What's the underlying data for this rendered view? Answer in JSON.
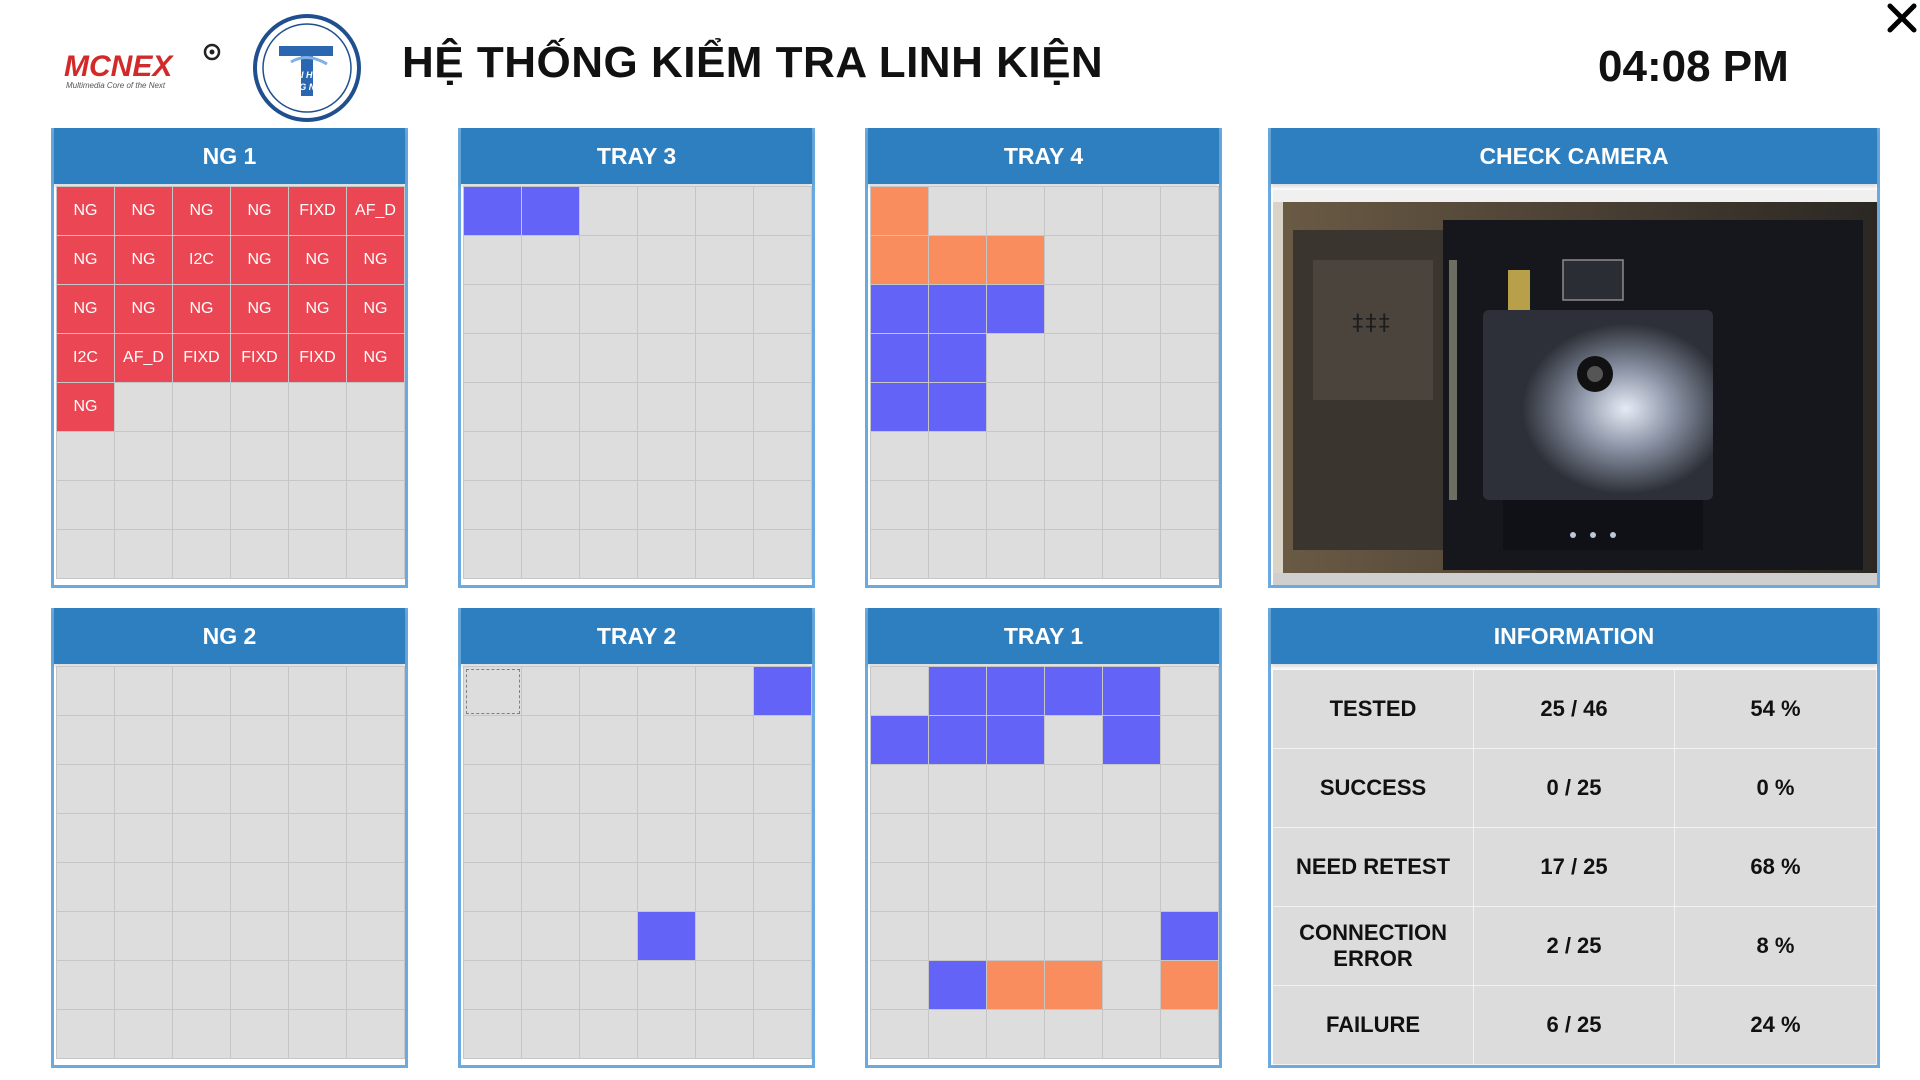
{
  "header": {
    "brand": "MCNEX",
    "brand_tagline": "Multimedia Core of the Next",
    "university_logo_text": [
      "ĐẠI HỌC",
      "CÔNG NGHỆ"
    ],
    "title": "HỆ THỐNG KIỂM TRA LINH KIỆN",
    "time": "04:08 PM",
    "close_icon": "close-icon"
  },
  "colors": {
    "header_bar": "#2e7fbf",
    "panel_border": "#6aaae0",
    "cell_empty": "#dddddd",
    "status_tested": "#6363f8",
    "status_retest": "#f98d5e",
    "status_failed": "#eb4653"
  },
  "trays": {
    "ng1": {
      "title": "NG 1",
      "cells": [
        [
          "NG",
          "NG",
          "NG",
          "NG",
          "FIXD",
          "AF_D"
        ],
        [
          "NG",
          "NG",
          "I2C",
          "NG",
          "NG",
          "NG"
        ],
        [
          "NG",
          "NG",
          "NG",
          "NG",
          "NG",
          "NG"
        ],
        [
          "I2C",
          "AF_D",
          "FIXD",
          "FIXD",
          "FIXD",
          "NG"
        ],
        [
          "NG",
          "",
          "",
          "",
          "",
          ""
        ],
        [
          "",
          "",
          "",
          "",
          "",
          ""
        ],
        [
          "",
          "",
          "",
          "",
          "",
          ""
        ],
        [
          "",
          "",
          "",
          "",
          "",
          ""
        ]
      ],
      "states": [
        [
          "red",
          "red",
          "red",
          "red",
          "red",
          "red"
        ],
        [
          "red",
          "red",
          "red",
          "red",
          "red",
          "red"
        ],
        [
          "red",
          "red",
          "red",
          "red",
          "red",
          "red"
        ],
        [
          "red",
          "red",
          "red",
          "red",
          "red",
          "red"
        ],
        [
          "red",
          "",
          "",
          "",
          "",
          ""
        ],
        [
          "",
          "",
          "",
          "",
          "",
          ""
        ],
        [
          "",
          "",
          "",
          "",
          "",
          ""
        ],
        [
          "",
          "",
          "",
          "",
          "",
          ""
        ]
      ]
    },
    "tray3": {
      "title": "TRAY 3",
      "states": [
        [
          "blue",
          "blue",
          "",
          "",
          "",
          ""
        ],
        [
          "",
          "",
          "",
          "",
          "",
          ""
        ],
        [
          "",
          "",
          "",
          "",
          "",
          ""
        ],
        [
          "",
          "",
          "",
          "",
          "",
          ""
        ],
        [
          "",
          "",
          "",
          "",
          "",
          ""
        ],
        [
          "",
          "",
          "",
          "",
          "",
          ""
        ],
        [
          "",
          "",
          "",
          "",
          "",
          ""
        ],
        [
          "",
          "",
          "",
          "",
          "",
          ""
        ]
      ]
    },
    "tray4": {
      "title": "TRAY 4",
      "states": [
        [
          "orange",
          "",
          "",
          "",
          "",
          ""
        ],
        [
          "orange",
          "orange",
          "orange",
          "",
          "",
          ""
        ],
        [
          "blue",
          "blue",
          "blue",
          "",
          "",
          ""
        ],
        [
          "blue",
          "blue",
          "",
          "",
          "",
          ""
        ],
        [
          "blue",
          "blue",
          "",
          "",
          "",
          ""
        ],
        [
          "",
          "",
          "",
          "",
          "",
          ""
        ],
        [
          "",
          "",
          "",
          "",
          "",
          ""
        ],
        [
          "",
          "",
          "",
          "",
          "",
          ""
        ]
      ]
    },
    "ng2": {
      "title": "NG 2",
      "states": [
        [
          "",
          "",
          "",
          "",
          "",
          ""
        ],
        [
          "",
          "",
          "",
          "",
          "",
          ""
        ],
        [
          "",
          "",
          "",
          "",
          "",
          ""
        ],
        [
          "",
          "",
          "",
          "",
          "",
          ""
        ],
        [
          "",
          "",
          "",
          "",
          "",
          ""
        ],
        [
          "",
          "",
          "",
          "",
          "",
          ""
        ],
        [
          "",
          "",
          "",
          "",
          "",
          ""
        ],
        [
          "",
          "",
          "",
          "",
          "",
          ""
        ]
      ]
    },
    "tray2": {
      "title": "TRAY 2",
      "states": [
        [
          "sel",
          "",
          "",
          "",
          "",
          "blue"
        ],
        [
          "",
          "",
          "",
          "",
          "",
          ""
        ],
        [
          "",
          "",
          "",
          "",
          "",
          ""
        ],
        [
          "",
          "",
          "",
          "",
          "",
          ""
        ],
        [
          "",
          "",
          "",
          "",
          "",
          ""
        ],
        [
          "",
          "",
          "",
          "blue",
          "",
          ""
        ],
        [
          "",
          "",
          "",
          "",
          "",
          ""
        ],
        [
          "",
          "",
          "",
          "",
          "",
          ""
        ]
      ]
    },
    "tray1": {
      "title": "TRAY 1",
      "states": [
        [
          "",
          "blue",
          "blue",
          "blue",
          "blue",
          ""
        ],
        [
          "blue",
          "blue",
          "blue",
          "",
          "blue",
          ""
        ],
        [
          "",
          "",
          "",
          "",
          "",
          ""
        ],
        [
          "",
          "",
          "",
          "",
          "",
          ""
        ],
        [
          "",
          "",
          "",
          "",
          "",
          ""
        ],
        [
          "",
          "",
          "",
          "",
          "",
          "blue"
        ],
        [
          "",
          "blue",
          "orange",
          "orange",
          "",
          "orange"
        ],
        [
          "",
          "",
          "",
          "",
          "",
          ""
        ]
      ]
    }
  },
  "camera": {
    "title": "CHECK CAMERA"
  },
  "information": {
    "title": "INFORMATION",
    "rows": [
      {
        "label": "TESTED",
        "count": "25 / 46",
        "percent": "54 %"
      },
      {
        "label": "SUCCESS",
        "count": "0 / 25",
        "percent": "0 %"
      },
      {
        "label": "NEED RETEST",
        "count": "17 / 25",
        "percent": "68 %"
      },
      {
        "label": "CONNECTION ERROR",
        "count": "2 / 25",
        "percent": "8 %"
      },
      {
        "label": "FAILURE",
        "count": "6 / 25",
        "percent": "24 %"
      }
    ]
  }
}
